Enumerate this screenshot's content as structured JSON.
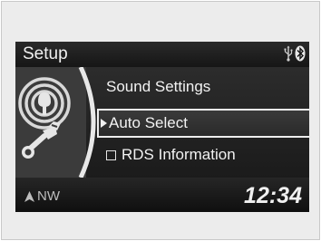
{
  "header": {
    "title": "Setup",
    "usb_icon": "usb-icon",
    "bluetooth_icon": "bluetooth-icon"
  },
  "menu": {
    "items": [
      {
        "label": "Sound Settings",
        "selected": false
      },
      {
        "label": "Auto Select",
        "selected": true
      },
      {
        "label": "RDS Information",
        "checkbox": true,
        "checked": false
      }
    ]
  },
  "footer": {
    "compass_direction": "NW",
    "clock": "12:34"
  },
  "colors": {
    "screen_bg": "#0c0c0c",
    "text": "#f2f2f2",
    "panel": "#3b3b3b",
    "highlight_border": "#ededed"
  }
}
